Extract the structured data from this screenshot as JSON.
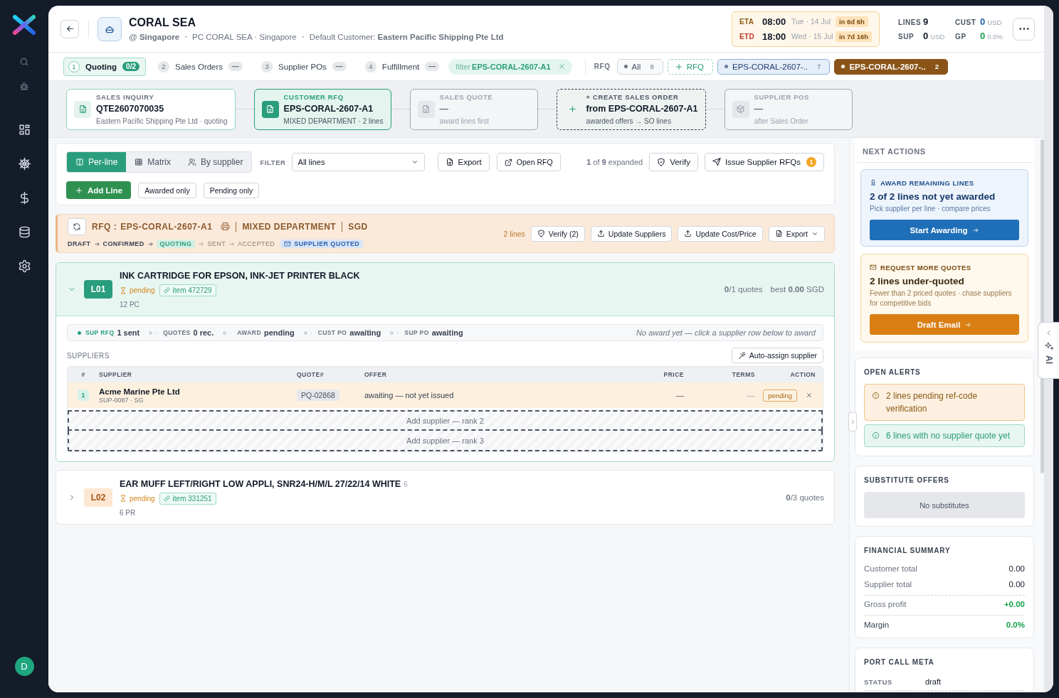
{
  "sidebar": {
    "avatar": "D"
  },
  "header": {
    "title": "CORAL SEA",
    "location": "@ **Singapore**",
    "port": "PC CORAL SEA · Singapore",
    "customer": "Default Customer: **Eastern Pacific Shipping Pte Ltd**",
    "schedule": [
      {
        "kind": "eta",
        "label": "ETA",
        "time": "08:00",
        "date": "Tue · 14 Jul",
        "countdown": "in 6d 6h"
      },
      {
        "kind": "etd",
        "label": "ETD",
        "time": "18:00",
        "date": "Wed · 15 Jul",
        "countdown": "in 7d 16h"
      }
    ],
    "stats": [
      {
        "kind": "count",
        "label": "LINES",
        "value": "9"
      },
      {
        "kind": "customer",
        "label": "CUST",
        "value": "0",
        "unit": "USD"
      },
      {
        "kind": "count",
        "label": "SUP",
        "value": "0",
        "unit": "USD"
      },
      {
        "kind": "profit",
        "label": "GP",
        "value": "0",
        "unit": "0.0%"
      }
    ]
  },
  "workflow_tabs": [
    {
      "step": "1",
      "label": "Quoting",
      "count": "0/2",
      "selected": true
    },
    {
      "step": "2",
      "label": "Sales Orders",
      "count": "—",
      "selected": false
    },
    {
      "step": "3",
      "label": "Supplier POs",
      "count": "—",
      "selected": false
    },
    {
      "step": "4",
      "label": "Fulfillment",
      "count": "—",
      "selected": false
    }
  ],
  "filter_chip": {
    "label": "filter",
    "value": "EPS-CORAL-2607-A1"
  },
  "rfq_filter": {
    "label": "RFQ",
    "chips": [
      {
        "kind": "all",
        "label": "All",
        "count": "9",
        "selected": false
      },
      {
        "kind": "add",
        "label": "RFQ",
        "selected": false
      },
      {
        "kind": "rfq",
        "label": "EPS-CORAL-2607-..",
        "count": "7",
        "selected": false
      },
      {
        "kind": "rfq",
        "label": "EPS-CORAL-2607-..",
        "count": "2",
        "selected": true
      }
    ]
  },
  "stages": [
    {
      "kind": "done",
      "title": "SALES INQUIRY",
      "value": "QTE2607070035",
      "sub": "Eastern Pacific Shipping Pte Ltd · quoting"
    },
    {
      "kind": "current",
      "title": "CUSTOMER RFQ",
      "value": "EPS-CORAL-2607-A1",
      "sub": "MIXED DEPARTMENT · 2 lines"
    },
    {
      "kind": "pending",
      "title": "SALES QUOTE",
      "value": "—",
      "sub": "award lines first"
    },
    {
      "kind": "action",
      "title": "+ CREATE SALES ORDER",
      "value": "from EPS-CORAL-2607-A1",
      "sub": "awarded offers → SO lines"
    },
    {
      "kind": "pending",
      "title": "SUPPLIER POS",
      "value": "—",
      "sub": "after Sales Order"
    }
  ],
  "toolbar": {
    "views": [
      {
        "label": "Per-line",
        "selected": true
      },
      {
        "label": "Matrix",
        "selected": false
      },
      {
        "label": "By supplier",
        "selected": false
      }
    ],
    "filter_label": "FILTER",
    "filter_value": "All lines",
    "export": "Export",
    "open_rfq": "Open RFQ",
    "expanded": "**1** of **9** expanded",
    "verify": "Verify",
    "issue": "Issue Supplier RFQs",
    "issue_count": "1",
    "add_line": "Add Line",
    "toggles": [
      "Awarded only",
      "Pending only"
    ]
  },
  "rfq_bar": {
    "label": "RFQ :",
    "id": "EPS-CORAL-2607-A1",
    "department": "MIXED DEPARTMENT",
    "currency": "SGD",
    "pipeline": [
      {
        "kind": "done",
        "label": "DRAFT"
      },
      {
        "kind": "done",
        "label": "CONFIRMED"
      },
      {
        "kind": "current",
        "label": "QUOTING"
      },
      {
        "kind": "future",
        "label": "SENT"
      },
      {
        "kind": "future",
        "label": "ACCEPTED"
      }
    ],
    "tag": "SUPPLIER QUOTED",
    "line_count": "2 lines",
    "actions": [
      "Verify (2)",
      "Update Suppliers",
      "Update Cost/Price",
      "Export"
    ]
  },
  "lines": [
    {
      "code": "L01",
      "title": "INK CARTRIDGE FOR EPSON, INK-JET PRINTER BLACK",
      "status": "pending",
      "item": "item 472729",
      "qty": "12 PC",
      "quotes": "**0**/1 quotes",
      "best": "best **0.00** SGD",
      "expanded": true,
      "progress": [
        {
          "label": "SUP RFQ",
          "value": "1 sent",
          "done": true
        },
        {
          "label": "QUOTES",
          "value": "0 rec.",
          "done": false
        },
        {
          "label": "AWARD",
          "value": "pending",
          "done": false
        },
        {
          "label": "CUST PO",
          "value": "awaiting",
          "done": false
        },
        {
          "label": "SUP PO",
          "value": "awaiting",
          "done": false
        }
      ],
      "hint": "No award yet — click a supplier row below to award",
      "suppliers_label": "SUPPLIERS",
      "auto_assign": "Auto-assign supplier",
      "columns": [
        "#",
        "SUPPLIER",
        "QUOTE#",
        "OFFER",
        "PRICE",
        "TERMS",
        "ACTION"
      ],
      "suppliers": [
        {
          "rank": "1",
          "name": "Acme Marine Pte Ltd",
          "code": "SUP-0087 · SG",
          "quote": "PQ-02868",
          "offer": "awaiting — not yet issued",
          "price": "—",
          "terms": "—",
          "status": "pending"
        }
      ],
      "empty_slots": [
        "Add supplier — rank 2",
        "Add supplier — rank 3"
      ]
    },
    {
      "code": "L02",
      "title": "EAR MUFF LEFT/RIGHT LOW APPLI, SNR24-H/M/L 27/22/14 WHITE",
      "title_note": "6",
      "status": "pending",
      "item": "item 331251",
      "qty": "6 PR",
      "quotes": "**0**/3 quotes",
      "expanded": false
    }
  ],
  "side_panel": {
    "title": "NEXT ACTIONS",
    "actions": [
      {
        "kind": "award",
        "title": "AWARD REMAINING LINES",
        "headline": "2 of 2 lines not yet awarded",
        "sub": "Pick supplier per line · compare prices",
        "button": "Start Awarding"
      },
      {
        "kind": "quotes",
        "title": "REQUEST MORE QUOTES",
        "headline": "2 lines under-quoted",
        "sub": "Fewer than 2 priced quotes · chase suppliers for competitive bids",
        "button": "Draft Email"
      }
    ],
    "alerts": {
      "title": "OPEN ALERTS",
      "items": [
        {
          "kind": "warning",
          "text": "2 lines pending ref-code verification"
        },
        {
          "kind": "info",
          "text": "6 lines with no supplier quote yet"
        }
      ]
    },
    "substitutes": {
      "title": "SUBSTITUTE OFFERS",
      "empty": "No substitutes"
    },
    "financial": {
      "title": "FINANCIAL SUMMARY",
      "rows": [
        {
          "kind": "plain",
          "label": "Customer total",
          "value": "0.00"
        },
        {
          "kind": "plain",
          "label": "Supplier total",
          "value": "0.00"
        },
        {
          "kind": "profit",
          "label": "Gross profit",
          "value": "+0.00"
        },
        {
          "kind": "total",
          "label": "Margin",
          "value": "0.0%"
        }
      ]
    },
    "meta": {
      "title": "PORT CALL META",
      "rows": [
        {
          "label": "STATUS",
          "value": "draft"
        }
      ]
    }
  },
  "ai_tab": {
    "label": "AI"
  }
}
